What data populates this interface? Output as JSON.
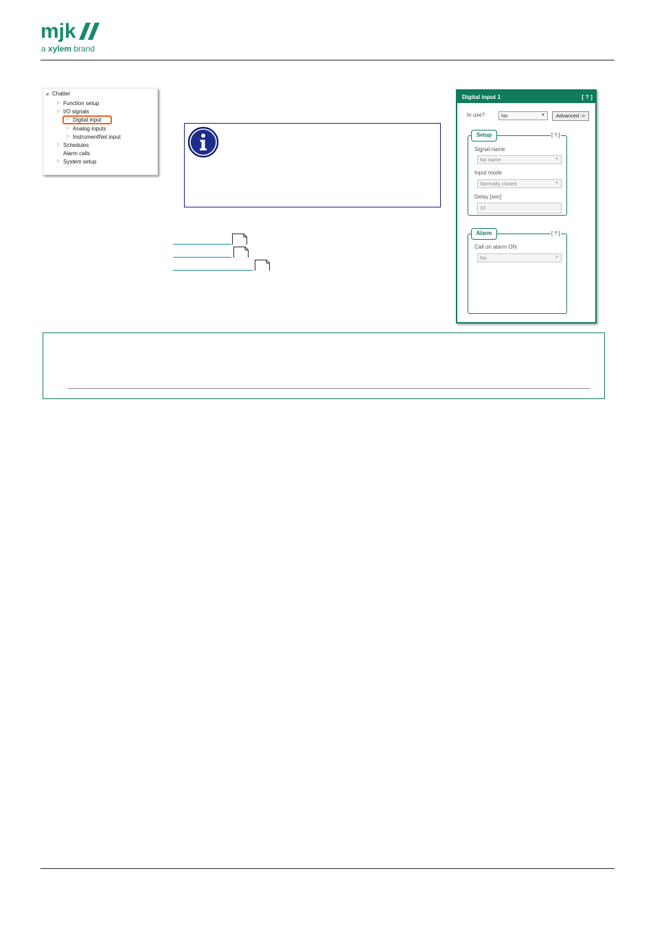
{
  "header": {
    "logo_text": "mjk",
    "logo_sub_prefix": "a ",
    "logo_sub_brand": "xylem",
    "logo_sub_suffix": " brand",
    "brand_color": "#1a8a6f"
  },
  "tree": {
    "items": [
      {
        "label": "Chatter",
        "arrow": "expanded"
      },
      {
        "label": "Function setup",
        "arrow": "collapsed"
      },
      {
        "label": "I/O signals",
        "arrow": "collapsed"
      },
      {
        "label": "Digital input",
        "arrow": "collapsed",
        "highlighted": true
      },
      {
        "label": "Analog inputs",
        "arrow": "collapsed"
      },
      {
        "label": "InstrumentNet input",
        "arrow": "collapsed"
      },
      {
        "label": "Schedules",
        "arrow": "collapsed"
      },
      {
        "label": "Alarm calls",
        "arrow": "none"
      },
      {
        "label": "System setup",
        "arrow": "collapsed"
      }
    ],
    "highlight_color": "#e8641e"
  },
  "info_box": {
    "icon": "info-icon",
    "border_color": "#1a1a7a"
  },
  "panel": {
    "title": "Digital input 1",
    "help": "[ ? ]",
    "in_use_label": "In use?",
    "in_use_value": "No",
    "advanced_button": "Advanced ->",
    "setup": {
      "tab": "Setup",
      "help": "[ ? ]",
      "signal_name_label": "Signal name",
      "signal_name_value": "No name",
      "input_mode_label": "Input mode",
      "input_mode_value": "Normally closed",
      "delay_label": "Delay [sec]",
      "delay_value": "10"
    },
    "alarm": {
      "tab": "Alarm",
      "help": "[ ? ]",
      "call_label": "Call on alarm ON",
      "call_value": "No"
    },
    "accent_color": "#0f7a5c"
  },
  "note_box": {
    "border_color": "#0f7a5c"
  }
}
